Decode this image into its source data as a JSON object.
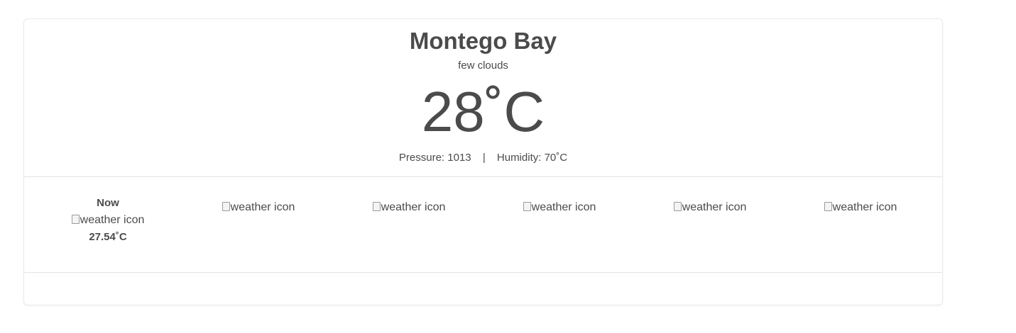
{
  "current": {
    "city": "Montego Bay",
    "description": "few clouds",
    "temperature": "28˚C",
    "pressure": "Pressure: 1013",
    "separator": "|",
    "humidity": "Humidity: 70˚C"
  },
  "forecast": [
    {
      "label": "Now",
      "icon_alt": "weather icon",
      "temp": "27.54˚C"
    },
    {
      "label": "",
      "icon_alt": "weather icon",
      "temp": ""
    },
    {
      "label": "",
      "icon_alt": "weather icon",
      "temp": ""
    },
    {
      "label": "",
      "icon_alt": "weather icon",
      "temp": ""
    },
    {
      "label": "",
      "icon_alt": "weather icon",
      "temp": ""
    },
    {
      "label": "",
      "icon_alt": "weather icon",
      "temp": ""
    }
  ]
}
